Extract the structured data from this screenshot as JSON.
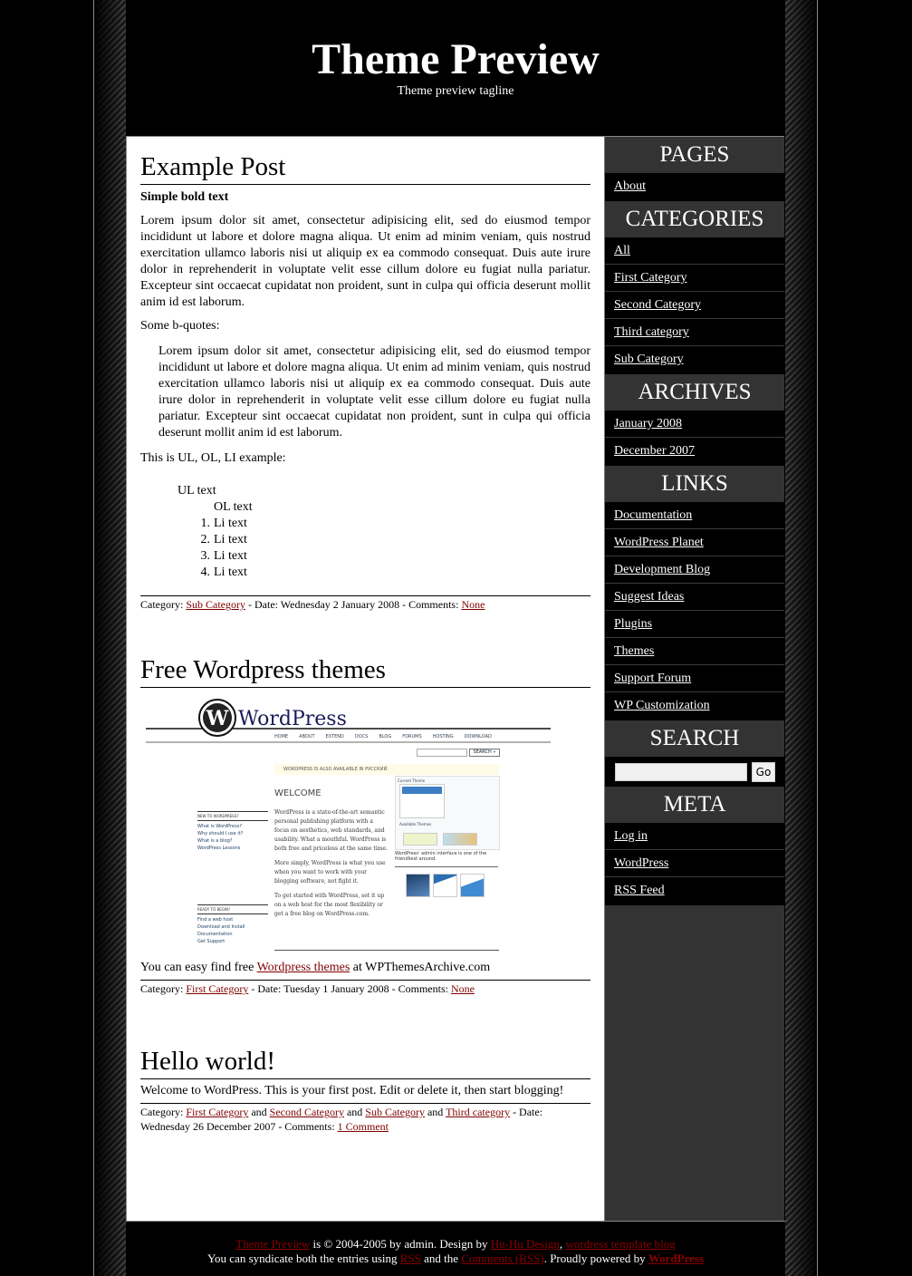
{
  "header": {
    "title": "Theme Preview",
    "tagline": "Theme preview tagline"
  },
  "posts": [
    {
      "title": "Example Post",
      "bold_text": "Simple bold text",
      "paragraph": "Lorem ipsum dolor sit amet, consectetur adipisicing elit, sed do eiusmod tempor incididunt ut labore et dolore magna aliqua. Ut enim ad minim veniam, quis nostrud exercitation ullamco laboris nisi ut aliquip ex ea commodo consequat. Duis aute irure dolor in reprehenderit in voluptate velit esse cillum dolore eu fugiat nulla pariatur. Excepteur sint occaecat cupidatat non proident, sunt in culpa qui officia deserunt mollit anim id est laborum.",
      "bquote_intro": "Some b-quotes:",
      "blockquote": "Lorem ipsum dolor sit amet, consectetur adipisicing elit, sed do eiusmod tempor incididunt ut labore et dolore magna aliqua. Ut enim ad minim veniam, quis nostrud exercitation ullamco laboris nisi ut aliquip ex ea commodo consequat. Duis aute irure dolor in reprehenderit in voluptate velit esse cillum dolore eu fugiat nulla pariatur. Excepteur sint occaecat cupidatat non proident, sunt in culpa qui officia deserunt mollit anim id est laborum.",
      "list_intro": "This is UL, OL, LI example:",
      "ul_text": "UL text",
      "ol_text": "OL text",
      "li_items": [
        "Li text",
        "Li text",
        "Li text",
        "Li text"
      ],
      "meta": {
        "category_label": "Category:",
        "categories": [
          "Sub Category"
        ],
        "date_text": "- Date: Wednesday 2 January 2008 - Comments:",
        "comments": "None"
      }
    },
    {
      "title": "Free Wordpress themes",
      "image": {
        "logo": "WordPress",
        "nav": [
          "HOME",
          "ABOUT",
          "EXTEND",
          "DOCS",
          "BLOG",
          "FORUMS",
          "HOSTING",
          "DOWNLOAD"
        ],
        "search_button": "SEARCH »",
        "notice": "WORDPRESS IS ALSO AVAILABLE IN РУССКИЙ.",
        "welcome": "WELCOME",
        "new_heading": "NEW TO WORDPRESS?",
        "new_links": [
          "What is WordPress?",
          "Why should I use it?",
          "What is a blog?",
          "WordPress Lessons"
        ],
        "ready_heading": "READY TO BEGIN?",
        "ready_links": [
          "Find a web host",
          "Download and Install",
          "Documentation",
          "Get Support"
        ],
        "intro_p1": "WordPress is a state-of-the-art semantic personal publishing platform with a focus on aesthetics, web standards, and usability. What a mouthful. WordPress is both free and priceless at the same time.",
        "intro_p2": "More simply, WordPress is what you use when you want to work with your blogging software, not fight it.",
        "intro_p3": "To get started with WordPress, set it up on a web host for the most flexibility or get a free blog on WordPress.com.",
        "current_theme": "Current Theme",
        "available_themes": "Available Themes",
        "caption": "WordPress' admin interface is one of the friendliest around."
      },
      "text_before": "You can easy find free",
      "text_link": "Wordpress themes",
      "text_after": "at WPThemesArchive.com",
      "meta": {
        "category_label": "Category:",
        "categories": [
          "First Category"
        ],
        "date_text": "- Date: Tuesday 1 January 2008 - Comments:",
        "comments": "None"
      }
    },
    {
      "title": "Hello world!",
      "paragraph": "Welcome to WordPress. This is your first post. Edit or delete it, then start blogging!",
      "meta": {
        "category_label": "Category:",
        "categories": [
          "First Category",
          "Second Category",
          "Sub Category",
          "Third category"
        ],
        "joiner": "and",
        "date_text": "- Date:",
        "date_line2": "Wednesday 26 December 2007 - Comments:",
        "comments": "1 Comment"
      }
    }
  ],
  "sidebar": {
    "pages": {
      "title": "PAGES",
      "items": [
        "About"
      ]
    },
    "categories": {
      "title": "CATEGORIES",
      "items": [
        "All",
        "First Category",
        "Second Category",
        "Third category",
        "Sub Category"
      ]
    },
    "archives": {
      "title": "ARCHIVES",
      "items": [
        "January 2008",
        "December 2007"
      ]
    },
    "links": {
      "title": "LINKS",
      "items": [
        "Documentation",
        "WordPress Planet",
        "Development Blog",
        "Suggest Ideas",
        "Plugins",
        "Themes",
        "Support Forum",
        "WP Customization"
      ]
    },
    "search": {
      "title": "SEARCH",
      "value": "",
      "button": "Go"
    },
    "meta": {
      "title": "META",
      "items": [
        "Log in",
        "WordPress",
        "RSS Feed"
      ]
    }
  },
  "footer": {
    "line1": {
      "site_link": "Theme Preview",
      "text1": "is © 2004-2005 by admin. Design by",
      "design_link": "Hu-Hu Design",
      "sep": ",",
      "template_link": "wordress template blog"
    },
    "line2": {
      "text1": "You can syndicate both the entries using",
      "rss_link": "RSS",
      "text2": "and the",
      "comments_link": "Comments (RSS)",
      "text3": ". Proudly powered by",
      "wp_link": "WordPress"
    }
  },
  "colors": {
    "link_red": "#800000",
    "sidebar_bg": "#333333",
    "content_bg": "#ffffff",
    "page_bg": "#000000"
  }
}
